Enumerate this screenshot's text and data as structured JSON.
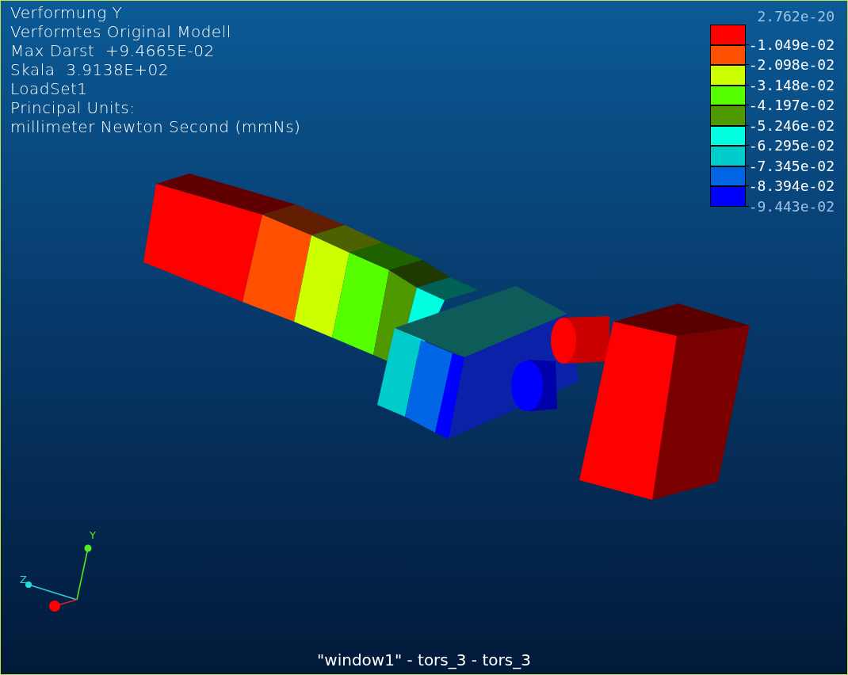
{
  "header_lines": [
    "Verformung Y",
    "Verformtes Original Modell",
    "Max Darst  +9.4665E-02",
    "Skala  3.9138E+02",
    "LoadSet1",
    "Principal Units:",
    "millimeter Newton Second (mmNs)"
  ],
  "legend": {
    "top_label": "2.762e-20",
    "bands": [
      {
        "color": "#ff0000",
        "label": "-1.049e-02",
        "dim": false
      },
      {
        "color": "#ff4f00",
        "label": "-2.098e-02",
        "dim": false
      },
      {
        "color": "#ccff00",
        "label": "-3.148e-02",
        "dim": false
      },
      {
        "color": "#55ff00",
        "label": "-4.197e-02",
        "dim": false
      },
      {
        "color": "#4f9900",
        "label": "-5.246e-02",
        "dim": false
      },
      {
        "color": "#00ffe1",
        "label": "-6.295e-02",
        "dim": false
      },
      {
        "color": "#00cccc",
        "label": "-7.345e-02",
        "dim": false
      },
      {
        "color": "#0066e6",
        "label": "-8.394e-02",
        "dim": false
      },
      {
        "color": "#0000ff",
        "label": "-9.443e-02",
        "dim": true
      }
    ]
  },
  "axes": {
    "y_label": "Y",
    "z_label": "Z"
  },
  "footer": "\"window1\" - tors_3 - tors_3"
}
